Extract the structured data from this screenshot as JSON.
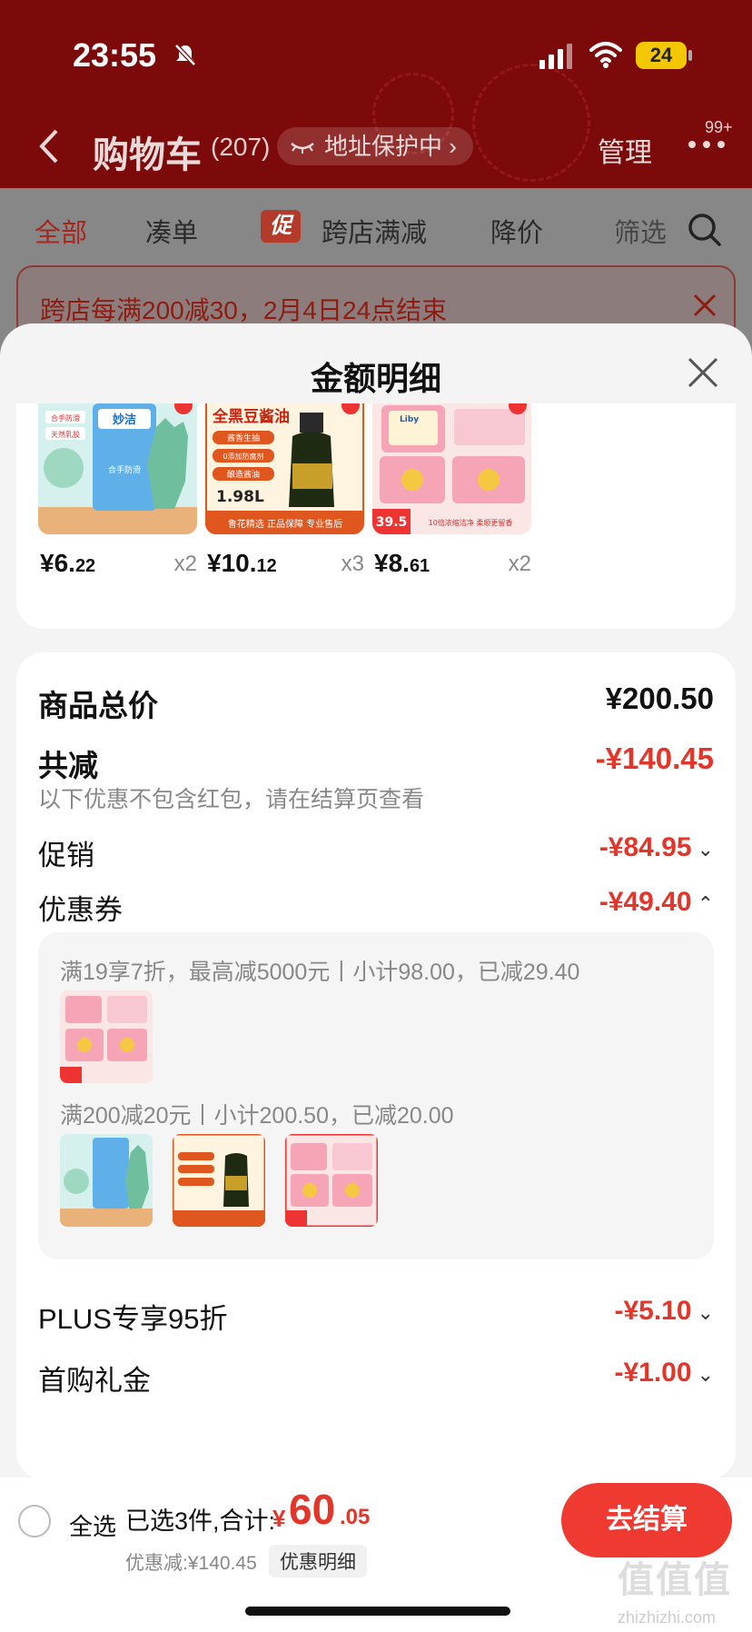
{
  "status_bar": {
    "time": "23:55",
    "battery": "24"
  },
  "header": {
    "title": "购物车",
    "count": "(207)",
    "address_pill": "地址保护中",
    "manage": "管理",
    "badge": "99+"
  },
  "tabs": {
    "all": "全部",
    "bundle": "凑单",
    "promo_tag": "促",
    "cross_store": "跨店满减",
    "price_drop": "降价",
    "filter": "筛选"
  },
  "notice": {
    "text": "跨店每满200减30，2月4日24点结束"
  },
  "sheet": {
    "title": "金额明细",
    "products": [
      {
        "name": "gloves",
        "price_int": "¥6.",
        "price_dec": "22",
        "qty": "x2"
      },
      {
        "name": "soy-sauce",
        "price_int": "¥10.",
        "price_dec": "12",
        "qty": "x3"
      },
      {
        "name": "detergent",
        "price_int": "¥8.",
        "price_dec": "61",
        "qty": "x2"
      }
    ],
    "summary": {
      "total_label": "商品总价",
      "total_value": "¥200.50",
      "reduce_label": "共减",
      "reduce_value": "-¥140.45",
      "reduce_note": "以下优惠不包含红包，请在结算页查看",
      "promo_label": "促销",
      "promo_value": "-¥84.95",
      "coupon_label": "优惠券",
      "coupon_value": "-¥49.40",
      "coupon_rule_1": "满19享7折，最高减5000元丨小计98.00，已减29.40",
      "coupon_rule_2": "满200减20元丨小计200.50，已减20.00",
      "plus_label": "PLUS专享95折",
      "plus_value": "-¥5.10",
      "first_label": "首购礼金",
      "first_value": "-¥1.00"
    }
  },
  "product_image_text": {
    "gloves_brand": "妙洁",
    "gloves_tag1": "合手防滑",
    "gloves_tag2": "天然乳胶",
    "gloves_side": "合手防滑",
    "sauce_title": "全黑豆酱油",
    "sauce_b1": "酱香生抽",
    "sauce_b2": "0添加防腐剂",
    "sauce_b3": "酿造酱油",
    "sauce_vol": "1.98L",
    "sauce_footer": "鲁花精选 正品保障 专业售后",
    "det_brand": "Liby",
    "det_price": "39.5",
    "det_footer": "10倍浓缩洁净 柔顺更留香"
  },
  "bottom_bar": {
    "select_all": "全选",
    "selected": "已选3件,合计:",
    "currency": "¥",
    "total_int": "60",
    "total_dec": ".05",
    "discount": "优惠减:¥140.45",
    "detail_button": "优惠明细",
    "checkout": "去结算",
    "watermark": "值值值",
    "watermark_url": "zhizhizhi.com"
  },
  "colors": {
    "accent": "#ef3a32",
    "header_bg": "#7d0a0a"
  }
}
